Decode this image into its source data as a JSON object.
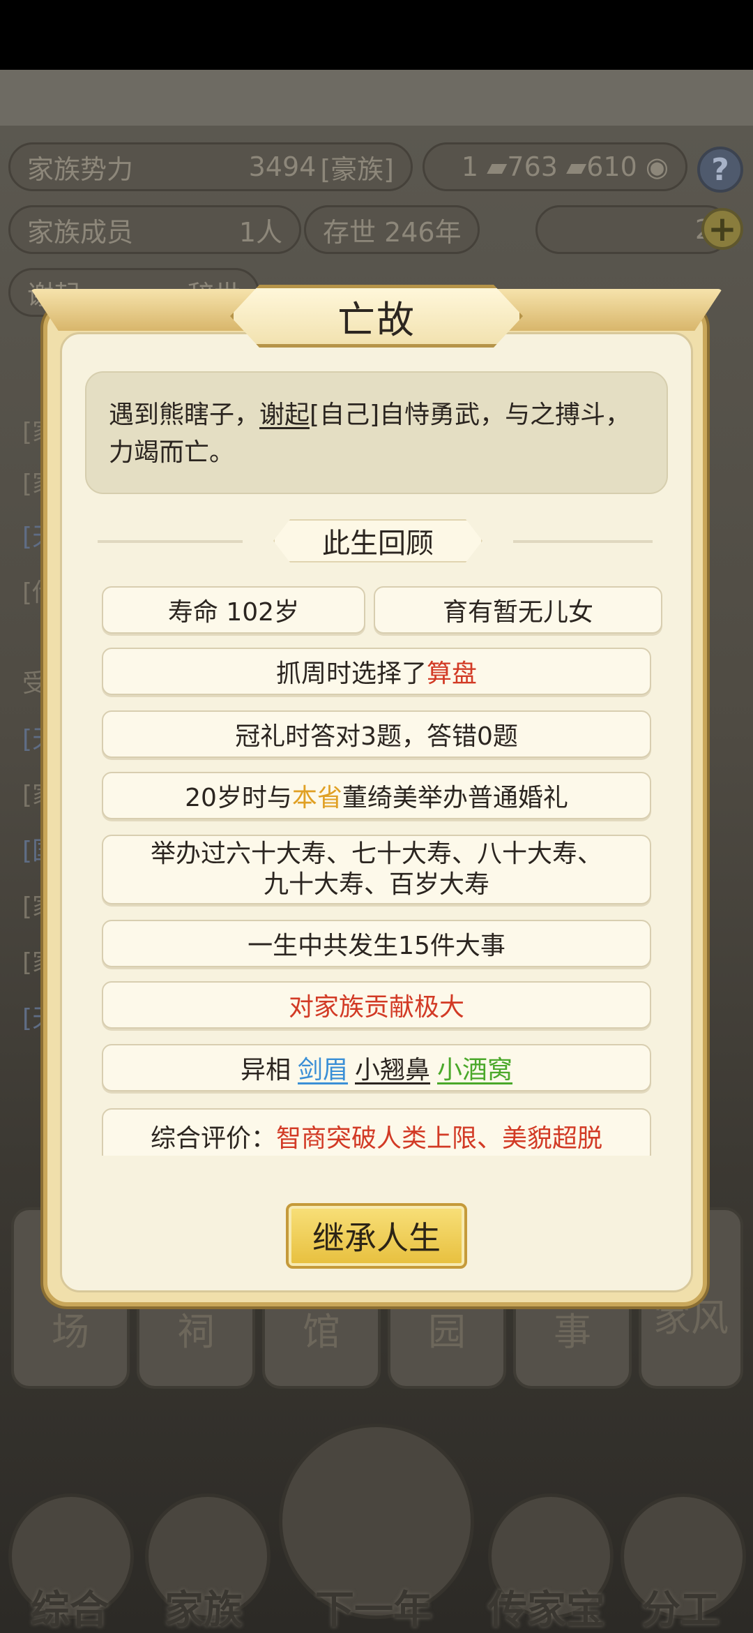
{
  "background": {
    "power_label": "家族势力",
    "power_value": "3494",
    "power_rank": "[豪族]",
    "resources": "1 ▰763 ▰610 ◉",
    "members_label": "家族成员",
    "members_value": "1人",
    "existence": "存世  246年",
    "gold_value": "2",
    "member_name": "谢起",
    "member_status": "辞世",
    "log_lines": [
      "[家",
      "[家",
      "[天",
      "[传",
      "受",
      "[天",
      "[家",
      "[国",
      "[家",
      "[家",
      "[天"
    ],
    "tiles": [
      "场",
      "祠",
      "馆",
      "园",
      "事",
      "家风"
    ],
    "nav": [
      "综合",
      "家族",
      "下一年",
      "传家宝",
      "分工"
    ]
  },
  "modal": {
    "title": "亡故",
    "cause_pre": "遇到熊瞎子，",
    "cause_name": "谢起",
    "cause_post": "[自己]自恃勇武，与之搏斗，力竭而亡。",
    "section_title": "此生回顾",
    "lifespan": "寿命 102岁",
    "children": "育有暂无儿女",
    "zhuazhou_pre": "抓周时选择了",
    "zhuazhou_item": "算盘",
    "guanli": "冠礼时答对3题，答错0题",
    "wedding_pre": "20岁时与",
    "wedding_place": "本省",
    "wedding_post": "董绮美举办普通婚礼",
    "birthdays_line1": "举办过六十大寿、七十大寿、八十大寿、",
    "birthdays_line2": "九十大寿、百岁大寿",
    "events": "一生中共发生15件大事",
    "contribution": "对家族贡献极大",
    "traits_label": "异相",
    "trait1": "剑眉",
    "trait2": "小翘鼻",
    "trait3": "小酒窝",
    "eval_label": "综合评价：",
    "eval_value": "智商突破人类上限、美貌超脱",
    "inherit_button": "继承人生"
  }
}
